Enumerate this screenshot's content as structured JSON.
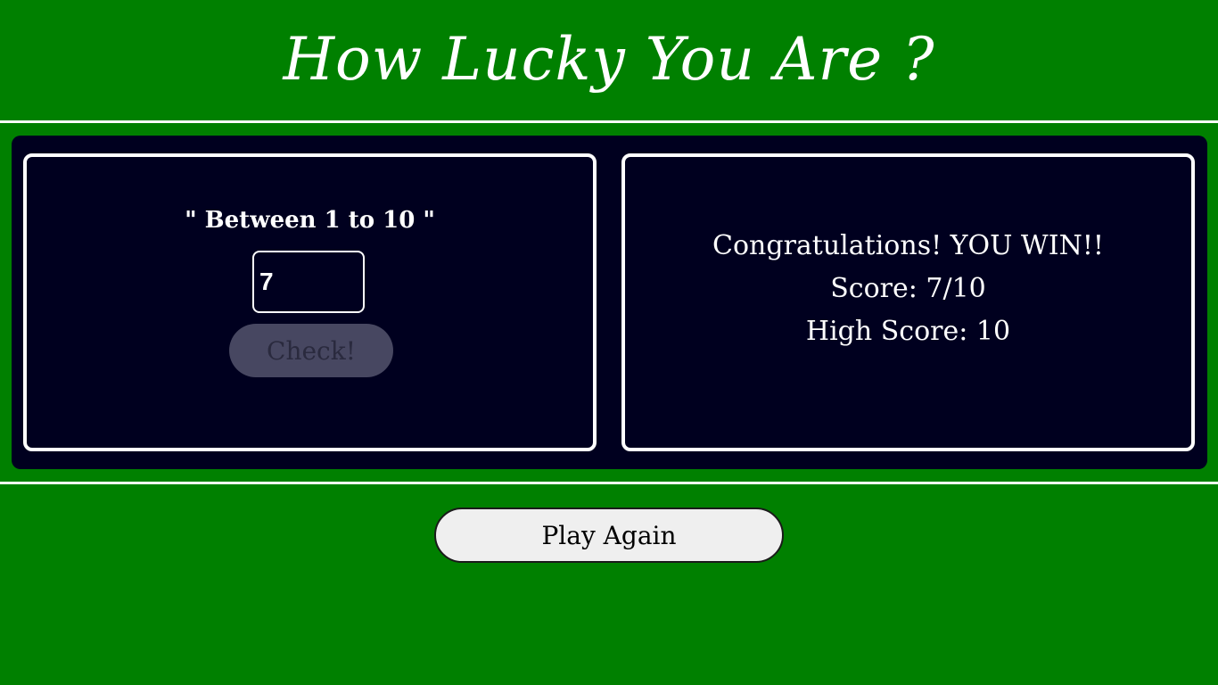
{
  "header": {
    "title": "How Lucky You Are ?"
  },
  "guess_card": {
    "range_label": "\" Between 1 to 10 \"",
    "input_value": "7",
    "check_label": "Check!",
    "check_disabled": true
  },
  "result_card": {
    "message": "Congratulations! YOU WIN!!",
    "score": "Score: 7/10",
    "high_score": "High Score: 10"
  },
  "footer": {
    "play_again_label": "Play Again"
  },
  "colors": {
    "background": "#008000",
    "panel": "#00001f",
    "border": "#ffffff",
    "disabled_button": "#474761",
    "play_again_button": "#efefef"
  }
}
